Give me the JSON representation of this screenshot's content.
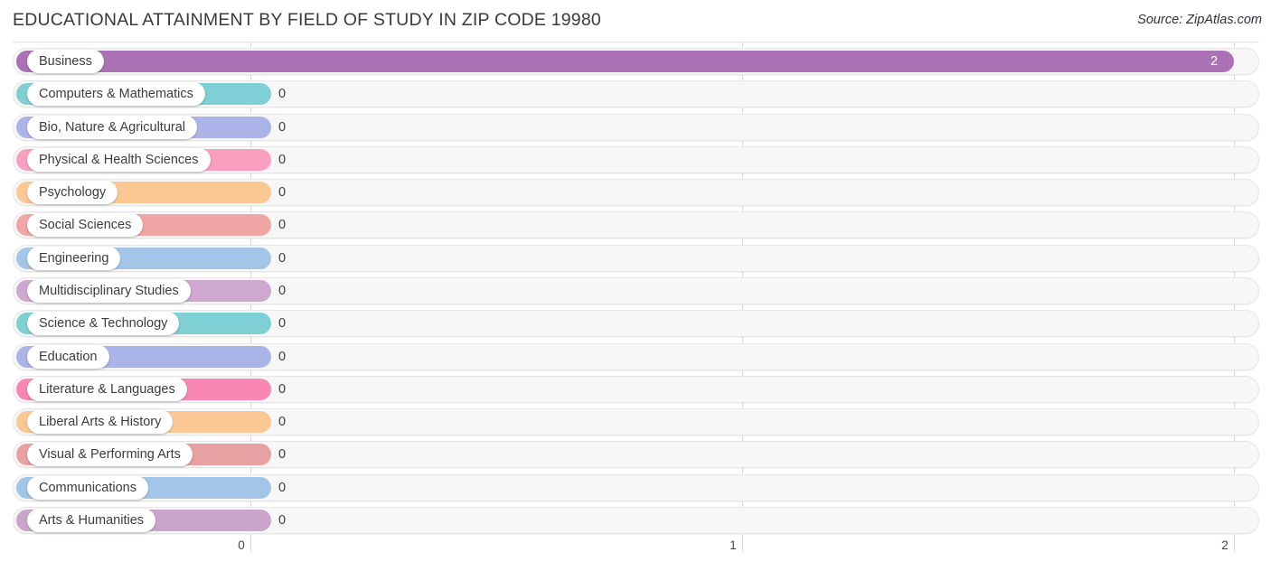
{
  "header": {
    "title": "EDUCATIONAL ATTAINMENT BY FIELD OF STUDY IN ZIP CODE 19980",
    "source": "Source: ZipAtlas.com"
  },
  "chart_data": {
    "type": "bar",
    "orientation": "horizontal",
    "title": "EDUCATIONAL ATTAINMENT BY FIELD OF STUDY IN ZIP CODE 19980",
    "xlabel": "",
    "ylabel": "",
    "xlim": [
      0,
      2
    ],
    "xticks": [
      0,
      1,
      2
    ],
    "xtick_labels": [
      "0",
      "1",
      "2"
    ],
    "grid": true,
    "legend": false,
    "categories": [
      "Business",
      "Computers & Mathematics",
      "Bio, Nature & Agricultural",
      "Physical & Health Sciences",
      "Psychology",
      "Social Sciences",
      "Engineering",
      "Multidisciplinary Studies",
      "Science & Technology",
      "Education",
      "Literature & Languages",
      "Liberal Arts & History",
      "Visual & Performing Arts",
      "Communications",
      "Arts & Humanities"
    ],
    "values": [
      2,
      0,
      0,
      0,
      0,
      0,
      0,
      0,
      0,
      0,
      0,
      0,
      0,
      0,
      0
    ],
    "value_labels": [
      "2",
      "0",
      "0",
      "0",
      "0",
      "0",
      "0",
      "0",
      "0",
      "0",
      "0",
      "0",
      "0",
      "0",
      "0"
    ],
    "bar_colors": [
      "#ab71b5",
      "#7fd0d4",
      "#aab4e8",
      "#f9a0c0",
      "#fbc894",
      "#efa6a4",
      "#a3c5e8",
      "#cfa8d0",
      "#7fd0d4",
      "#aab4e8",
      "#f986b4",
      "#fbc894",
      "#e8a0a2",
      "#a3c5e8",
      "#c9a6c9"
    ]
  }
}
